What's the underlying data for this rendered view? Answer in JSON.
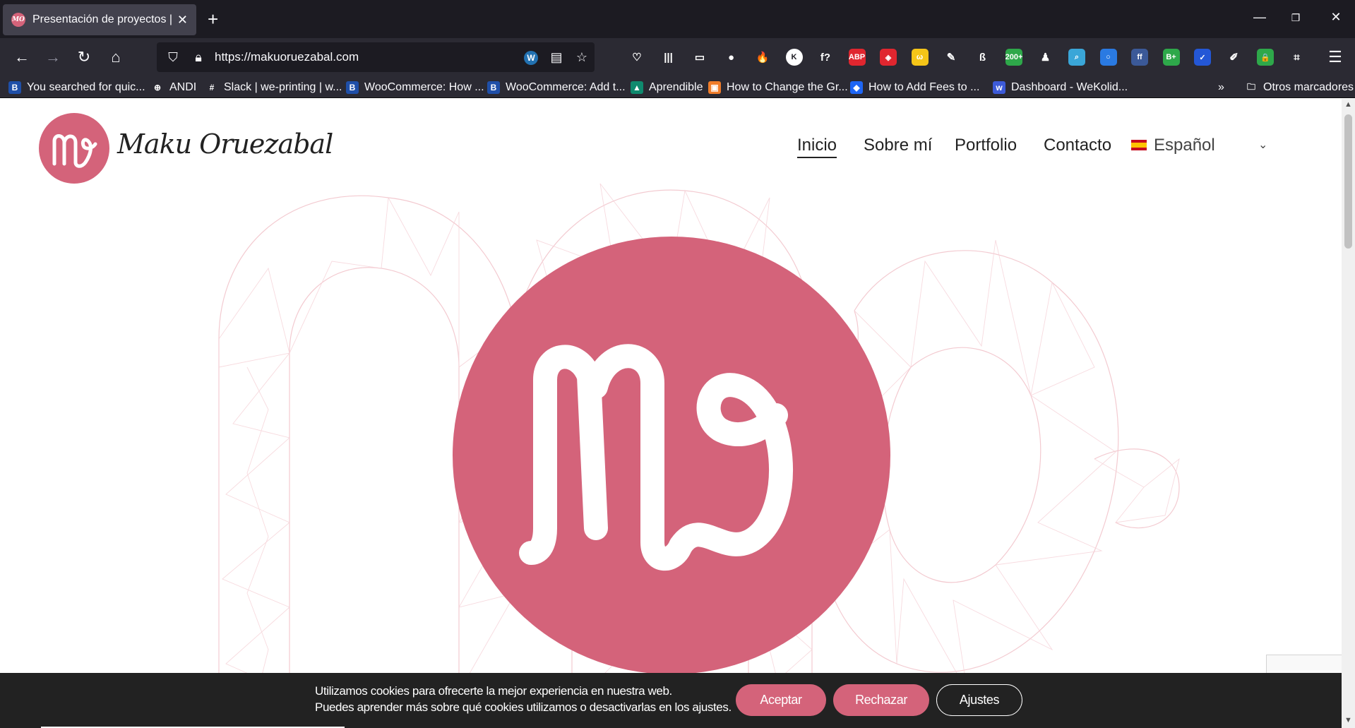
{
  "browser": {
    "tab_title": "Presentación de proyectos | Ma",
    "tab_favicon_text": "MO",
    "url": "https://makuoruezabal.com",
    "bookmarks": [
      {
        "label": "You searched for quic...",
        "icon_color": "#1f4fa8",
        "icon_text": "B"
      },
      {
        "label": "ANDI",
        "icon_color": "transparent",
        "icon_text": "⊕"
      },
      {
        "label": "Slack | we-printing | w...",
        "icon_color": "transparent",
        "icon_text": "#"
      },
      {
        "label": "WooCommerce: How ...",
        "icon_color": "#1f4fa8",
        "icon_text": "B"
      },
      {
        "label": "WooCommerce: Add t...",
        "icon_color": "#1f4fa8",
        "icon_text": "B"
      },
      {
        "label": "Aprendible",
        "icon_color": "#0f8a6e",
        "icon_text": "▲"
      },
      {
        "label": "How to Change the Gr...",
        "icon_color": "#f07d2a",
        "icon_text": "▣"
      },
      {
        "label": "How to Add Fees to ...",
        "icon_color": "#1e66f5",
        "icon_text": "◆"
      },
      {
        "label": "Dashboard - WeKolid...",
        "icon_color": "#3d5bd9",
        "icon_text": "w"
      }
    ],
    "other_bookmarks": "Otros marcadores",
    "extensions": [
      {
        "name": "pocket-icon",
        "color": "transparent",
        "text": "♡"
      },
      {
        "name": "library-icon",
        "color": "transparent",
        "text": "|||"
      },
      {
        "name": "reader-icon",
        "color": "transparent",
        "text": "▭"
      },
      {
        "name": "extension-ball-icon",
        "color": "transparent",
        "text": "●"
      },
      {
        "name": "extension-fire-icon",
        "color": "transparent",
        "text": "🔥"
      },
      {
        "name": "extension-k-icon",
        "color": "#ffffff",
        "text": "K"
      },
      {
        "name": "extension-font-icon",
        "color": "transparent",
        "text": "f?"
      },
      {
        "name": "adblock-icon",
        "color": "#e0262f",
        "text": "ABP"
      },
      {
        "name": "extension-shield-icon",
        "color": "#e0262f",
        "text": "◈"
      },
      {
        "name": "extension-w-icon",
        "color": "#f5c518",
        "text": "ω"
      },
      {
        "name": "extension-feather-icon",
        "color": "transparent",
        "text": "✎"
      },
      {
        "name": "extension-s-icon",
        "color": "transparent",
        "text": "ß"
      },
      {
        "name": "extension-counter-icon",
        "color": "#2ea84a",
        "text": "200+"
      },
      {
        "name": "extension-person-icon",
        "color": "transparent",
        "text": "♟"
      },
      {
        "name": "extension-search-icon",
        "color": "#3aa6d8",
        "text": "⌕"
      },
      {
        "name": "extension-ring-icon",
        "color": "#2a7ae2",
        "text": "○"
      },
      {
        "name": "extension-ff-icon",
        "color": "#3b5998",
        "text": "ff"
      },
      {
        "name": "extension-bplus-icon",
        "color": "#2ea84a",
        "text": "B+"
      },
      {
        "name": "extension-check-icon",
        "color": "#2457d6",
        "text": "✓"
      },
      {
        "name": "extension-edit-icon",
        "color": "transparent",
        "text": "✐"
      },
      {
        "name": "extension-lock-icon",
        "color": "#2ea84a",
        "text": "🔒"
      },
      {
        "name": "extension-crop-icon",
        "color": "transparent",
        "text": "⌗"
      }
    ]
  },
  "site": {
    "brand": "Maku Oruezabal",
    "nav": [
      "Inicio",
      "Sobre mí",
      "Portfolio",
      "Contacto"
    ],
    "language": "Español",
    "brand_color": "#d4637a"
  },
  "cookie": {
    "line1": "Utilizamos cookies para ofrecerte la mejor experiencia en nuestra web.",
    "line2": "Puedes aprender más sobre qué cookies utilizamos o desactivarlas en los ajustes.",
    "accept": "Aceptar",
    "reject": "Rechazar",
    "settings": "Ajustes"
  }
}
